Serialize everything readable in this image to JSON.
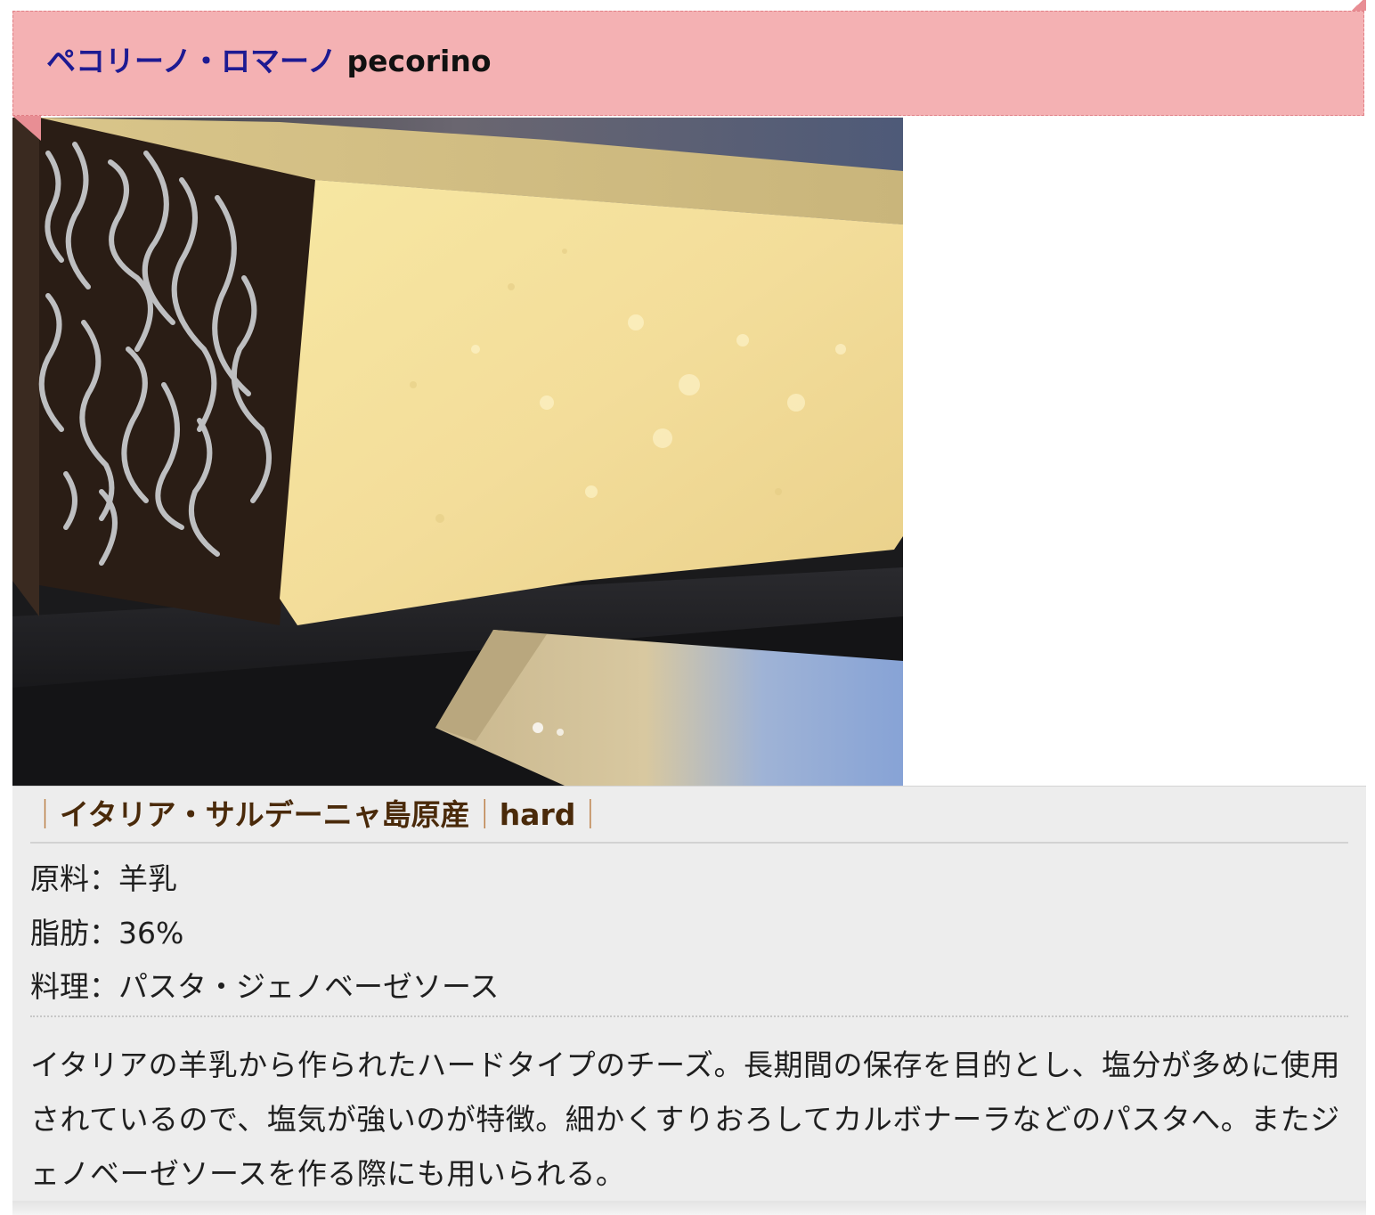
{
  "title": {
    "name_jp": "ペコリーノ・ロマーノ",
    "name_en": "pecorino"
  },
  "photo": {
    "icon": "cheese-photo"
  },
  "subhead": {
    "bar": "｜",
    "origin": "イタリア・サルデーニャ島原産",
    "type": "hard"
  },
  "attributes": [
    {
      "label": "原料",
      "value": "羊乳"
    },
    {
      "label": "脂肪",
      "value": "36%"
    },
    {
      "label": "料理",
      "value": "パスタ・ジェノベーゼソース"
    }
  ],
  "attr_separator": "：",
  "description": "イタリアの羊乳から作られたハードタイプのチーズ。長期間の保存を目的とし、塩分が多めに使用されているので、塩気が強いのが特徴。細かくすりおろしてカルボナーラなどのパスタへ。またジェノベーゼソースを作る際にも用いられる。",
  "colors": {
    "title_bg": "#f4b1b3",
    "title_text": "#1d1a92",
    "subhead_text": "#4a2a0a",
    "panel_bg": "#ededed"
  }
}
